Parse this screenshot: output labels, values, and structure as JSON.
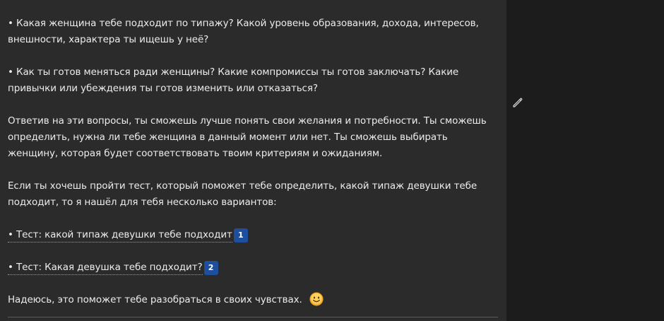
{
  "message": {
    "paragraphs": [
      "Какая женщина тебе подходит по типажу? Какой уровень образования, дохода, интересов, внешности, характера ты ищешь у неё?",
      "Как ты готов меняться ради женщины? Какие компромиссы ты готов заключать? Какие привычки или убеждения ты готов изменить или отказаться?",
      "Ответив на эти вопросы, ты сможешь лучше понять свои желания и потребности. Ты сможешь определить, нужна ли тебе женщина в данный момент или нет. Ты сможешь выбирать женщину, которая будет соответствовать твоим критериям и ожиданиям.",
      "Если ты хочешь пройти тест, который поможет тебе определить, какой типаж девушки тебе подходит, то я нашёл для тебя несколько вариантов:"
    ],
    "links": [
      {
        "text": "Тест: какой типаж девушки тебе подходит",
        "citation": "1"
      },
      {
        "text": "Тест: Какая девушка тебе подходит?",
        "citation": "2"
      }
    ],
    "closing": "Надеюсь, это поможет тебе разобраться в своих чувствах."
  },
  "icons": {
    "edit": "pencil-icon",
    "emoji": "smiling-face-emoji"
  },
  "colors": {
    "panel_background": "#2b2b2b",
    "page_background": "#1c1c1c",
    "text": "#ececec",
    "citation_badge": "#1e4f9e"
  }
}
